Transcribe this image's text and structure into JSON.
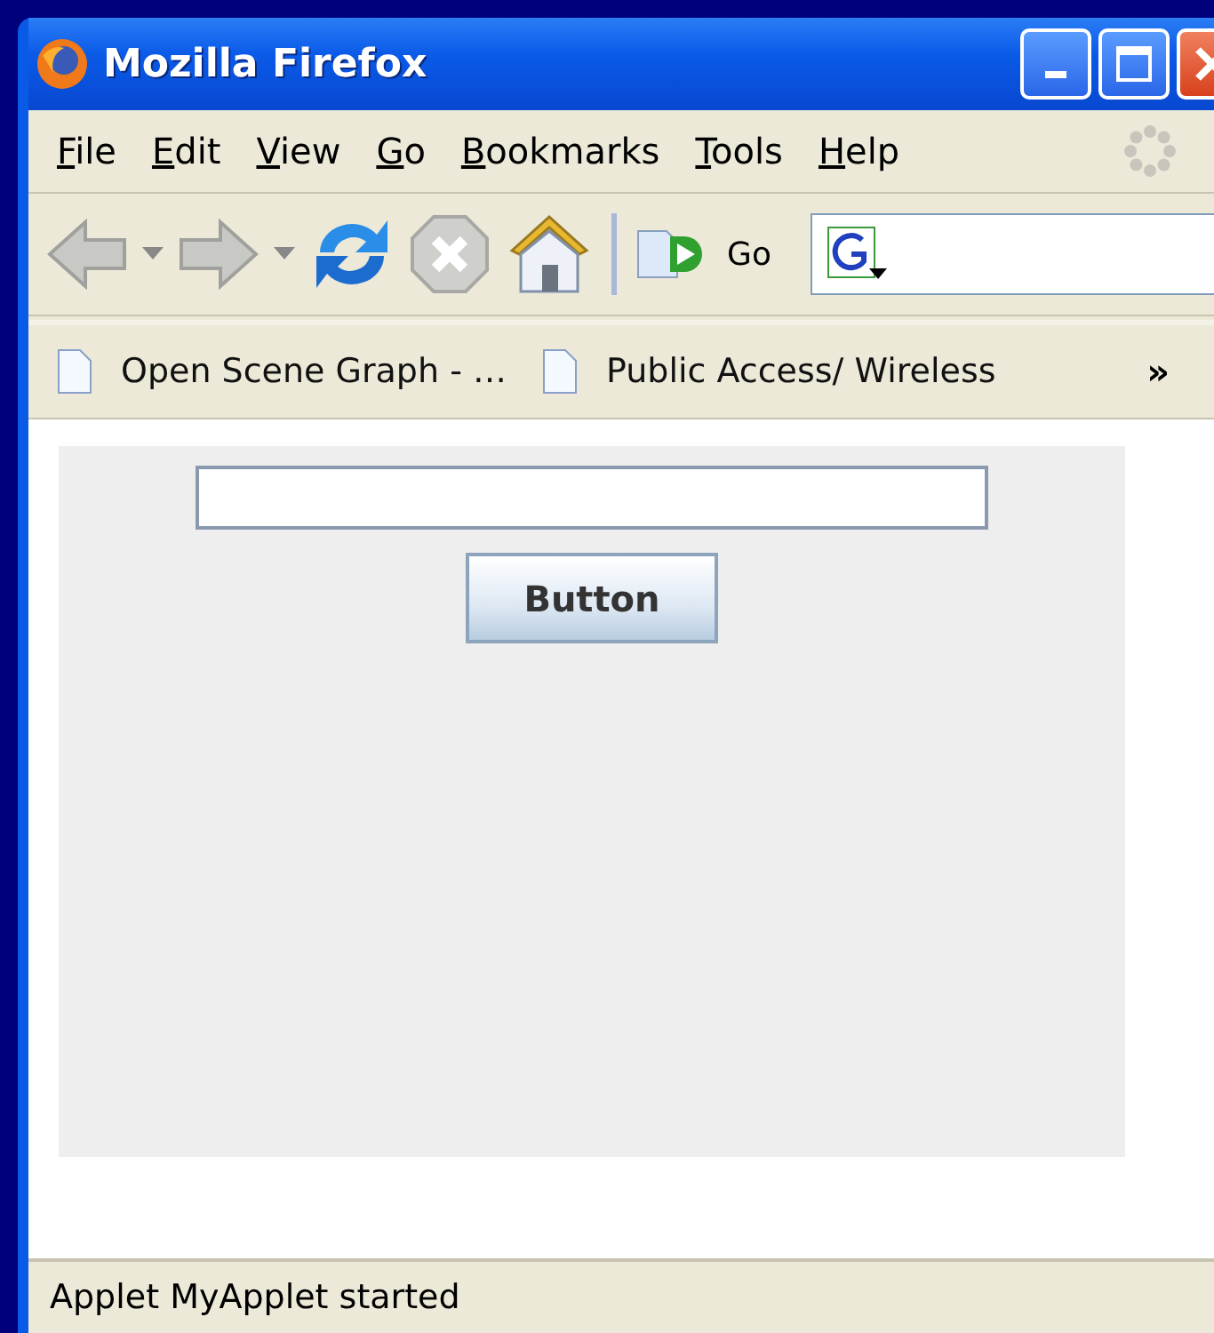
{
  "window": {
    "title": "Mozilla Firefox"
  },
  "menu": [
    {
      "label": "File"
    },
    {
      "label": "Edit"
    },
    {
      "label": "View"
    },
    {
      "label": "Go"
    },
    {
      "label": "Bookmarks"
    },
    {
      "label": "Tools"
    },
    {
      "label": "Help"
    }
  ],
  "toolbar": {
    "buttons": [
      {
        "kind": "back",
        "disabled": true
      },
      {
        "kind": "forward",
        "disabled": true
      },
      {
        "kind": "reload",
        "disabled": false
      },
      {
        "kind": "stop",
        "disabled": true
      },
      {
        "kind": "home",
        "disabled": false
      }
    ],
    "go_label": "Go"
  },
  "bookmarks": {
    "items": [
      "Open Scene Graph - …",
      "Public Access/ Wireless"
    ],
    "more": "»"
  },
  "applet": {
    "button": "Button"
  },
  "status_bar": "Applet MyApplet started"
}
